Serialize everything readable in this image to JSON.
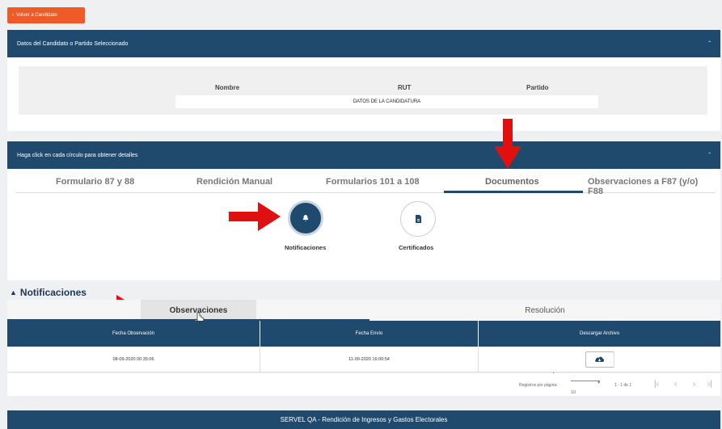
{
  "back_button": {
    "label": "Volver a Candidato"
  },
  "candidate_panel": {
    "title": "Datos del Candidato o Partido Seleccionado",
    "columns": [
      "Nombre",
      "RUT",
      "Partido"
    ],
    "value": "DATOS DE LA CANDIDATURA"
  },
  "details_panel": {
    "title": "Haga click en cada círculo para obtener detalles",
    "tabs": [
      "Formulario 87 y 88",
      "Rendición Manual",
      "Formularios 101 a 108",
      "Documentos",
      "Observaciones a F87 (y/o) F88"
    ],
    "active_tab": "Documentos",
    "circles": [
      {
        "label": "Notificaciones",
        "icon": "bell-icon"
      },
      {
        "label": "Certificados",
        "icon": "document-icon"
      }
    ]
  },
  "notifications": {
    "title": "Notificaciones",
    "subtabs": [
      "Observaciones",
      "Resolución"
    ],
    "table": {
      "headers": [
        "Fecha Observación",
        "Fecha Envío",
        "Descargar Archivo"
      ],
      "rows": [
        [
          "08-09-2020 00:35:06",
          "11-09-2020 16:00:54"
        ]
      ]
    },
    "pager": {
      "per_page_label": "Registros por página:",
      "per_page_value": "10",
      "range": "1 - 1 de 1"
    }
  },
  "footer": {
    "text": "SERVEL QA - Rendición de Ingresos y Gastos Electorales"
  },
  "colors": {
    "primary": "#1f4a6e",
    "accent": "#f05a28",
    "arrow": "#e01010"
  }
}
